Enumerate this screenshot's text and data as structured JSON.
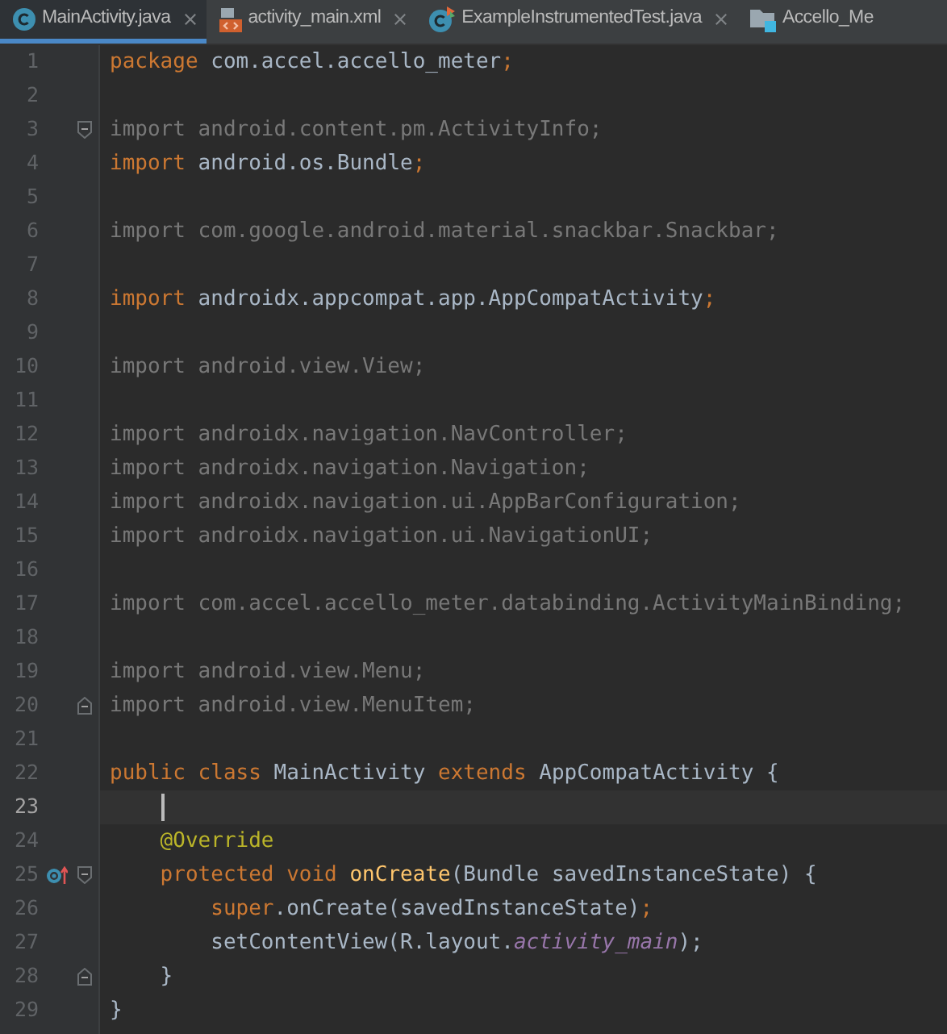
{
  "tabs": [
    {
      "label": "MainActivity.java",
      "kind": "class",
      "selected": true,
      "closable": true
    },
    {
      "label": "activity_main.xml",
      "kind": "xml",
      "selected": false,
      "closable": true
    },
    {
      "label": "ExampleInstrumentedTest.java",
      "kind": "test",
      "selected": false,
      "closable": true
    },
    {
      "label": "Accello_Me",
      "kind": "folder",
      "selected": false,
      "closable": false
    }
  ],
  "lines": [
    {
      "number": "1",
      "current": false,
      "fold_start": false,
      "fold_end": false,
      "tokens": [
        {
          "text": "package",
          "kind": "keyword"
        },
        {
          "text": " com.accel.accello_meter",
          "kind": "plain"
        },
        {
          "text": ";",
          "kind": "keyword"
        }
      ]
    },
    {
      "number": "2",
      "current": false,
      "fold_start": false,
      "fold_end": false
    },
    {
      "number": "3",
      "current": false,
      "fold_start": true,
      "fold_end": false,
      "tokens": [
        {
          "text": "import android.content.pm.ActivityInfo;",
          "kind": "unused"
        }
      ]
    },
    {
      "number": "4",
      "current": false,
      "fold_start": false,
      "fold_end": false,
      "tokens": [
        {
          "text": "import",
          "kind": "keyword"
        },
        {
          "text": " android.os.Bundle",
          "kind": "plain"
        },
        {
          "text": ";",
          "kind": "keyword"
        }
      ]
    },
    {
      "number": "5",
      "current": false,
      "fold_start": false,
      "fold_end": false
    },
    {
      "number": "6",
      "current": false,
      "fold_start": false,
      "fold_end": false,
      "tokens": [
        {
          "text": "import com.google.android.material.snackbar.Snackbar;",
          "kind": "unused"
        }
      ]
    },
    {
      "number": "7",
      "current": false,
      "fold_start": false,
      "fold_end": false
    },
    {
      "number": "8",
      "current": false,
      "fold_start": false,
      "fold_end": false,
      "tokens": [
        {
          "text": "import",
          "kind": "keyword"
        },
        {
          "text": " androidx.appcompat.app.AppCompatActivity",
          "kind": "plain"
        },
        {
          "text": ";",
          "kind": "keyword"
        }
      ]
    },
    {
      "number": "9",
      "current": false,
      "fold_start": false,
      "fold_end": false
    },
    {
      "number": "10",
      "current": false,
      "fold_start": false,
      "fold_end": false,
      "tokens": [
        {
          "text": "import android.view.View;",
          "kind": "unused"
        }
      ]
    },
    {
      "number": "11",
      "current": false,
      "fold_start": false,
      "fold_end": false
    },
    {
      "number": "12",
      "current": false,
      "fold_start": false,
      "fold_end": false,
      "tokens": [
        {
          "text": "import androidx.navigation.NavController;",
          "kind": "unused"
        }
      ]
    },
    {
      "number": "13",
      "current": false,
      "fold_start": false,
      "fold_end": false,
      "tokens": [
        {
          "text": "import androidx.navigation.Navigation;",
          "kind": "unused"
        }
      ]
    },
    {
      "number": "14",
      "current": false,
      "fold_start": false,
      "fold_end": false,
      "tokens": [
        {
          "text": "import androidx.navigation.ui.AppBarConfiguration;",
          "kind": "unused"
        }
      ]
    },
    {
      "number": "15",
      "current": false,
      "fold_start": false,
      "fold_end": false,
      "tokens": [
        {
          "text": "import androidx.navigation.ui.NavigationUI;",
          "kind": "unused"
        }
      ]
    },
    {
      "number": "16",
      "current": false,
      "fold_start": false,
      "fold_end": false
    },
    {
      "number": "17",
      "current": false,
      "fold_start": false,
      "fold_end": false,
      "tokens": [
        {
          "text": "import com.accel.accello_meter.databinding.ActivityMainBinding;",
          "kind": "unused"
        }
      ]
    },
    {
      "number": "18",
      "current": false,
      "fold_start": false,
      "fold_end": false
    },
    {
      "number": "19",
      "current": false,
      "fold_start": false,
      "fold_end": false,
      "tokens": [
        {
          "text": "import android.view.Menu;",
          "kind": "unused"
        }
      ]
    },
    {
      "number": "20",
      "current": false,
      "fold_start": false,
      "fold_end": true,
      "tokens": [
        {
          "text": "import android.view.MenuItem;",
          "kind": "unused"
        }
      ]
    },
    {
      "number": "21",
      "current": false,
      "fold_start": false,
      "fold_end": false
    },
    {
      "number": "22",
      "current": false,
      "fold_start": false,
      "fold_end": false,
      "tokens": [
        {
          "text": "public class",
          "kind": "keyword"
        },
        {
          "text": " MainActivity ",
          "kind": "plain"
        },
        {
          "text": "extends",
          "kind": "keyword"
        },
        {
          "text": " AppCompatActivity {",
          "kind": "plain"
        }
      ]
    },
    {
      "number": "23",
      "current": true,
      "fold_start": false,
      "fold_end": false
    },
    {
      "number": "24",
      "current": false,
      "fold_start": false,
      "fold_end": false,
      "tokens": [
        {
          "text": "    @Override",
          "kind": "annotation"
        }
      ]
    },
    {
      "number": "25",
      "current": false,
      "fold_start": true,
      "fold_end": false,
      "gutter": {
        "kind": "override"
      },
      "tokens": [
        {
          "text": "    protected void ",
          "kind": "keyword"
        },
        {
          "text": "onCreate",
          "kind": "method"
        },
        {
          "text": "(Bundle savedInstanceState) {",
          "kind": "plain"
        }
      ]
    },
    {
      "number": "26",
      "current": false,
      "fold_start": false,
      "fold_end": false,
      "tokens": [
        {
          "text": "        super",
          "kind": "keyword"
        },
        {
          "text": ".onCreate(savedInstanceState)",
          "kind": "plain"
        },
        {
          "text": ";",
          "kind": "keyword"
        }
      ]
    },
    {
      "number": "27",
      "current": false,
      "fold_start": false,
      "fold_end": false,
      "tokens": [
        {
          "text": "        setContentView(R.layout.",
          "kind": "plain"
        },
        {
          "text": "activity_main",
          "kind": "field"
        },
        {
          "text": ");",
          "kind": "plain"
        }
      ]
    },
    {
      "number": "28",
      "current": false,
      "fold_start": false,
      "fold_end": true,
      "tokens": [
        {
          "text": "    }",
          "kind": "plain"
        }
      ]
    },
    {
      "number": "29",
      "current": false,
      "fold_start": false,
      "fold_end": false,
      "tokens": [
        {
          "text": "}",
          "kind": "plain"
        }
      ]
    }
  ]
}
